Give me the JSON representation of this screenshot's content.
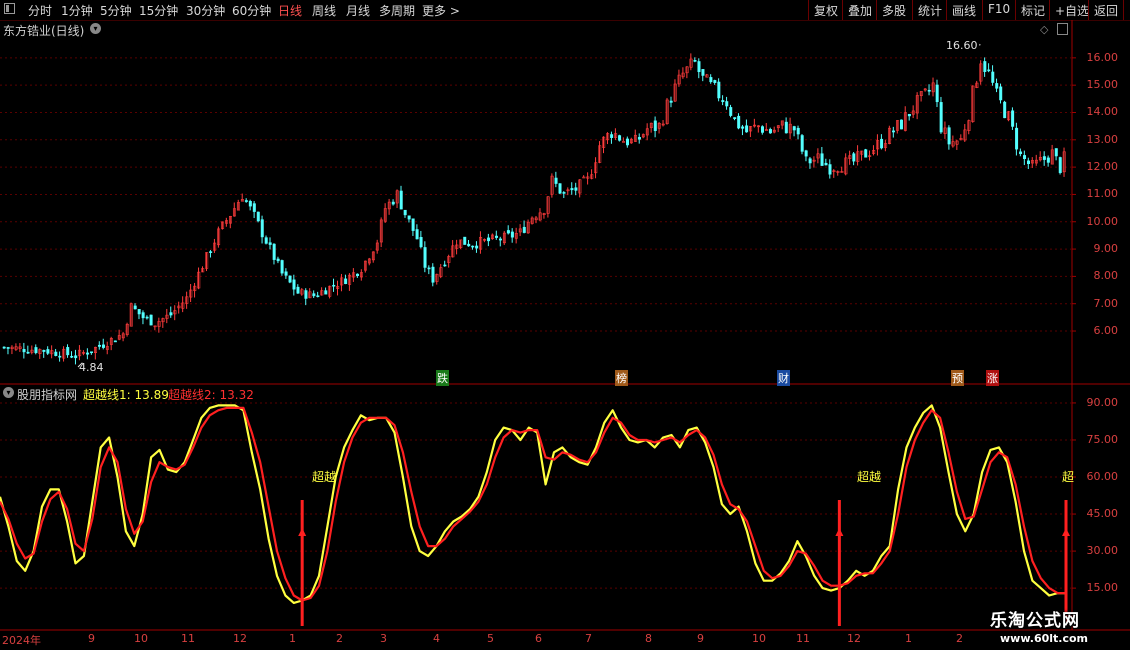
{
  "toolbar": {
    "periods": [
      "分时",
      "1分钟",
      "5分钟",
      "15分钟",
      "30分钟",
      "60分钟",
      "日线",
      "周线",
      "月线",
      "多周期",
      "更多"
    ],
    "active": "日线",
    "more_arrow": ">",
    "right_buttons": [
      "复权",
      "叠加",
      "多股",
      "统计",
      "画线",
      "F10",
      "标记",
      "+自选",
      "返回"
    ]
  },
  "main_panel": {
    "title": "东方锆业(日线)",
    "high_label": "16.60",
    "low_label": "4.84",
    "events": [
      {
        "text": "跌",
        "bg": "#1a7a1a"
      },
      {
        "text": "榜",
        "bg": "#a05a1a"
      },
      {
        "text": "财",
        "bg": "#1a4aa0"
      },
      {
        "text": "预",
        "bg": "#a05a1a"
      },
      {
        "text": "涨",
        "bg": "#b01010"
      }
    ]
  },
  "indicator_panel": {
    "name": "股朋指标网",
    "line1_label": "超越线1: 13.89",
    "line2_label": "超越线2: 13.32",
    "signal_label": "超越",
    "signal_partial": "超"
  },
  "time_axis": {
    "months": [
      "2024年",
      "9",
      "10",
      "11",
      "12",
      "1",
      "2",
      "3",
      "4",
      "5",
      "6",
      "7",
      "8",
      "9",
      "10",
      "11",
      "12",
      "1",
      "2"
    ]
  },
  "watermark": {
    "name": "乐淘公式网",
    "url": "www.60lt.com"
  },
  "chart_data": [
    {
      "type": "candlestick",
      "y_ticks": [
        6.0,
        7.0,
        8.0,
        9.0,
        10.0,
        11.0,
        12.0,
        13.0,
        14.0,
        15.0,
        16.0
      ],
      "ylim": [
        4.5,
        16.8
      ],
      "close_path": [
        [
          0,
          5.4
        ],
        [
          5,
          5.35
        ],
        [
          10,
          5.3
        ],
        [
          14,
          5.2
        ],
        [
          18,
          5.1
        ],
        [
          22,
          5.3
        ],
        [
          26,
          5.6
        ],
        [
          30,
          5.9
        ],
        [
          32,
          6.9
        ],
        [
          35,
          6.5
        ],
        [
          38,
          6.3
        ],
        [
          42,
          6.6
        ],
        [
          46,
          7.2
        ],
        [
          50,
          8.4
        ],
        [
          54,
          9.6
        ],
        [
          58,
          10.5
        ],
        [
          60,
          11.0
        ],
        [
          63,
          10.2
        ],
        [
          66,
          9.3
        ],
        [
          70,
          8.1
        ],
        [
          74,
          7.4
        ],
        [
          78,
          7.3
        ],
        [
          82,
          7.6
        ],
        [
          86,
          7.9
        ],
        [
          90,
          8.3
        ],
        [
          94,
          9.3
        ],
        [
          96,
          10.5
        ],
        [
          99,
          11.0
        ],
        [
          101,
          10.3
        ],
        [
          104,
          9.4
        ],
        [
          106,
          8.4
        ],
        [
          108,
          7.9
        ],
        [
          111,
          8.6
        ],
        [
          114,
          9.3
        ],
        [
          118,
          9.2
        ],
        [
          122,
          9.3
        ],
        [
          126,
          9.4
        ],
        [
          130,
          9.6
        ],
        [
          133,
          10.2
        ],
        [
          136,
          10.5
        ],
        [
          138,
          11.5
        ],
        [
          141,
          11.0
        ],
        [
          144,
          11.2
        ],
        [
          147,
          11.5
        ],
        [
          150,
          12.8
        ],
        [
          153,
          13.3
        ],
        [
          156,
          13.0
        ],
        [
          159,
          12.9
        ],
        [
          162,
          13.4
        ],
        [
          165,
          13.5
        ],
        [
          168,
          14.6
        ],
        [
          171,
          15.4
        ],
        [
          174,
          15.8
        ],
        [
          176,
          15.2
        ],
        [
          179,
          14.8
        ],
        [
          182,
          14.4
        ],
        [
          184,
          13.7
        ],
        [
          187,
          13.3
        ],
        [
          190,
          13.5
        ],
        [
          193,
          13.3
        ],
        [
          196,
          13.5
        ],
        [
          199,
          13.4
        ],
        [
          202,
          12.2
        ],
        [
          205,
          12.3
        ],
        [
          208,
          12.0
        ],
        [
          211,
          12.1
        ],
        [
          214,
          12.2
        ],
        [
          217,
          12.5
        ],
        [
          220,
          12.8
        ],
        [
          223,
          13.2
        ],
        [
          226,
          13.6
        ],
        [
          229,
          14.2
        ],
        [
          232,
          14.6
        ],
        [
          234,
          15.0
        ],
        [
          236,
          13.5
        ],
        [
          238,
          12.9
        ],
        [
          241,
          13.0
        ],
        [
          243,
          14.0
        ],
        [
          246,
          16.0
        ],
        [
          248,
          15.4
        ],
        [
          250,
          14.6
        ],
        [
          253,
          13.8
        ],
        [
          256,
          12.4
        ],
        [
          259,
          12.0
        ],
        [
          262,
          12.3
        ],
        [
          264,
          12.5
        ],
        [
          266,
          12.0
        ],
        [
          268,
          12.6
        ]
      ],
      "high_point": 16.6,
      "low_point": 4.84
    },
    {
      "type": "line",
      "y_ticks": [
        15.0,
        30.0,
        45.0,
        60.0,
        75.0,
        90.0
      ],
      "ylim": [
        11,
        92
      ],
      "series": [
        {
          "name": "超越线1",
          "color": "#ffff40",
          "values": [
            52,
            40,
            26,
            22,
            30,
            48,
            55,
            55,
            42,
            25,
            28,
            50,
            72,
            76,
            60,
            38,
            32,
            45,
            68,
            71,
            63,
            62,
            66,
            75,
            84,
            88,
            89,
            89,
            89,
            87,
            70,
            55,
            35,
            20,
            12,
            9,
            10,
            12,
            20,
            40,
            60,
            72,
            79,
            85,
            83,
            84,
            84,
            78,
            60,
            40,
            30,
            28,
            32,
            38,
            42,
            44,
            47,
            52,
            62,
            75,
            80,
            79,
            75,
            80,
            78,
            57,
            70,
            72,
            68,
            66,
            65,
            72,
            82,
            87,
            80,
            75,
            74,
            75,
            72,
            76,
            77,
            72,
            79,
            80,
            74,
            64,
            49,
            45,
            48,
            38,
            25,
            18,
            18,
            21,
            26,
            34,
            28,
            20,
            15,
            14,
            15,
            18,
            22,
            20,
            22,
            28,
            32,
            55,
            72,
            80,
            86,
            89,
            80,
            62,
            45,
            38,
            45,
            62,
            71,
            72,
            66,
            50,
            30,
            18,
            15,
            12,
            13,
            13
          ]
        },
        {
          "name": "超越线2",
          "color": "#ff2020",
          "values": [
            50,
            43,
            33,
            27,
            29,
            42,
            51,
            54,
            47,
            33,
            30,
            43,
            64,
            72,
            66,
            47,
            37,
            42,
            58,
            66,
            64,
            63,
            65,
            72,
            80,
            85,
            87,
            88,
            88,
            88,
            78,
            66,
            48,
            30,
            19,
            12,
            10,
            11,
            16,
            30,
            50,
            66,
            76,
            82,
            84,
            84,
            84,
            81,
            70,
            54,
            40,
            32,
            32,
            35,
            40,
            43,
            46,
            50,
            57,
            68,
            76,
            79,
            78,
            79,
            79,
            68,
            67,
            70,
            69,
            67,
            66,
            70,
            78,
            84,
            82,
            77,
            75,
            75,
            74,
            75,
            76,
            74,
            77,
            79,
            76,
            69,
            57,
            49,
            47,
            42,
            32,
            22,
            19,
            20,
            24,
            30,
            29,
            24,
            18,
            16,
            16,
            17,
            20,
            21,
            21,
            25,
            30,
            45,
            64,
            75,
            82,
            87,
            84,
            70,
            54,
            43,
            44,
            55,
            66,
            70,
            68,
            57,
            40,
            26,
            19,
            15,
            13,
            13
          ]
        }
      ],
      "signals_index": [
        36,
        100,
        127
      ]
    }
  ]
}
